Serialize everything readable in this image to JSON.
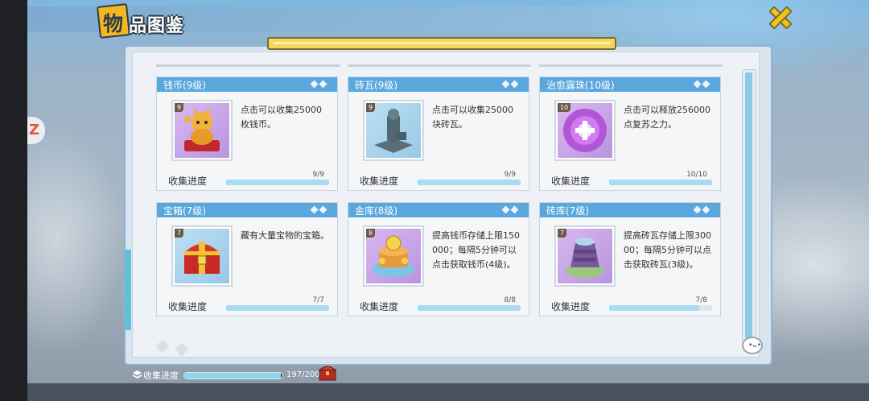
{
  "header": {
    "title_first": "物",
    "title_rest": "品图鉴"
  },
  "colors": {
    "card_header": "#5aa7dd",
    "progress_fill": "#a9dcf0",
    "accent_gold": "#f3c21c"
  },
  "items": [
    {
      "name": "钱币(9级)",
      "level": "9",
      "description": "点击可以收集25000枚钱币。",
      "progress_label": "收集进度",
      "count": "9/9",
      "progress": 1.0,
      "icon": "lucky-cat-icon"
    },
    {
      "name": "砖瓦(9级)",
      "level": "9",
      "description": "点击可以收集25000块砖瓦。",
      "progress_label": "收集进度",
      "count": "9/9",
      "progress": 1.0,
      "icon": "stone-statue-icon"
    },
    {
      "name": "治愈露珠(10级)",
      "level": "10",
      "description": "点击可以释放256000点复苏之力。",
      "progress_label": "收集进度",
      "count": "10/10",
      "progress": 1.0,
      "icon": "healing-orb-icon"
    },
    {
      "name": "宝箱(7级)",
      "level": "7",
      "description": "藏有大量宝物的宝箱。",
      "progress_label": "收集进度",
      "count": "7/7",
      "progress": 1.0,
      "icon": "treasure-chest-icon"
    },
    {
      "name": "金库(8级)",
      "level": "8",
      "description": "提高钱币存储上限150000；每隔5分钟可以点击获取钱币(4级)。",
      "progress_label": "收集进度",
      "count": "8/8",
      "progress": 1.0,
      "icon": "gold-vault-icon"
    },
    {
      "name": "砖库(7级)",
      "level": "7",
      "description": "提高砖瓦存储上限30000；每隔5分钟可以点击获取砖瓦(3级)。",
      "progress_label": "收集进度",
      "count": "7/8",
      "progress": 0.875,
      "icon": "brick-vault-icon"
    }
  ],
  "footer": {
    "label": "收集进度",
    "count": "197/200",
    "progress": 0.985
  }
}
